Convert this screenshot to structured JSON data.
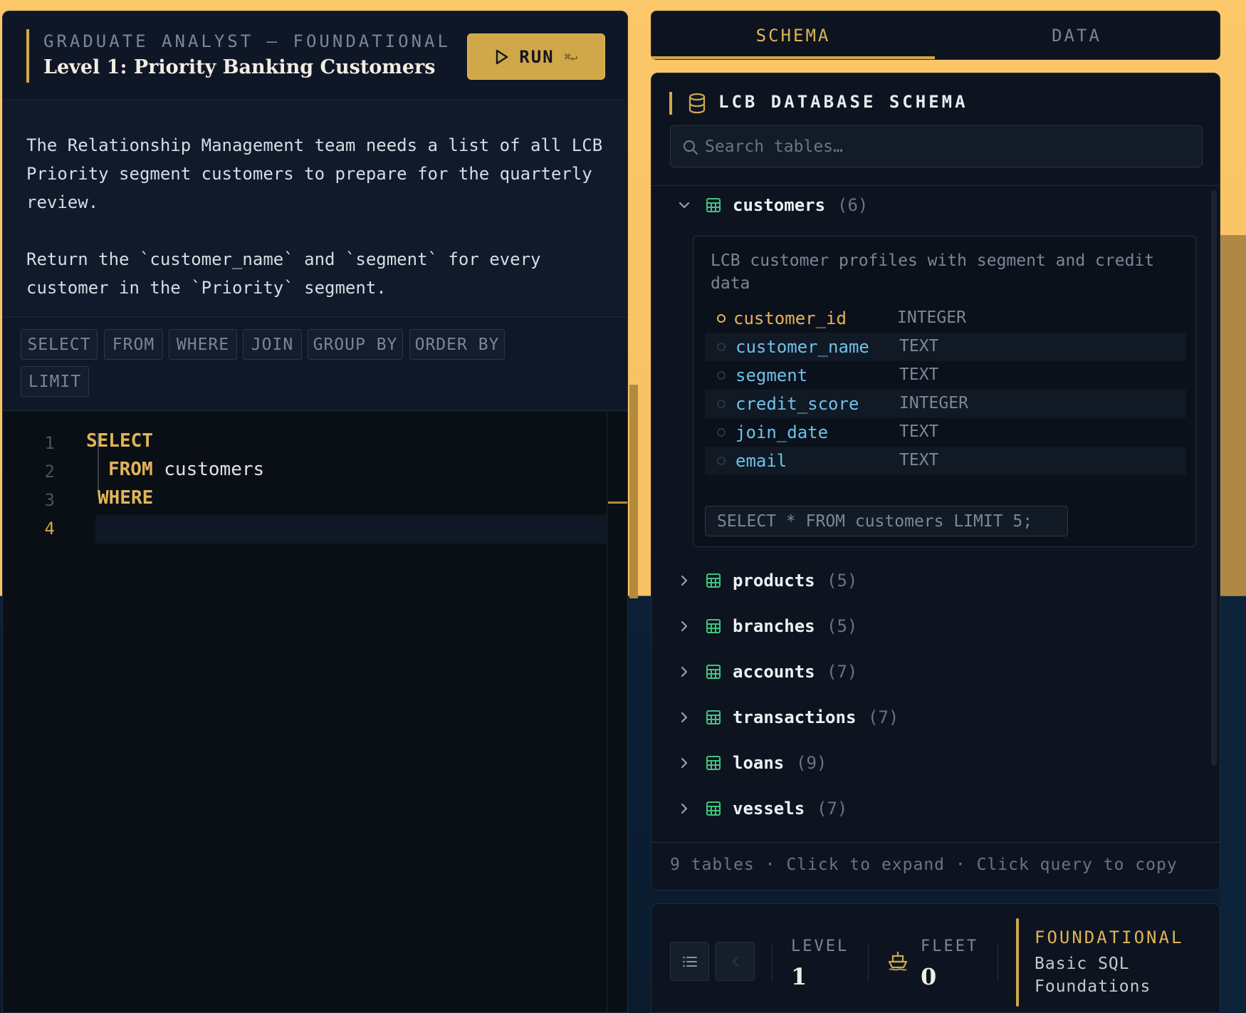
{
  "header": {
    "kicker": "GRADUATE ANALYST — FOUNDATIONAL",
    "title": "Level 1: Priority Banking Customers",
    "run_label": "RUN",
    "run_shortcut": "⌘↵"
  },
  "description": {
    "paragraph1": "The Relationship Management team needs a list of all LCB Priority segment customers to prepare for the quarterly review.",
    "paragraph2": "Return the `customer_name` and `segment` for every customer in the `Priority` segment."
  },
  "keywords": [
    "SELECT",
    "FROM",
    "WHERE",
    "JOIN",
    "GROUP BY",
    "ORDER BY",
    "LIMIT"
  ],
  "editor": {
    "line_numbers": [
      "1",
      "2",
      "3",
      "4"
    ],
    "lines": [
      {
        "keyword": "SELECT",
        "rest": ""
      },
      {
        "keyword": "FROM",
        "rest": " customers"
      },
      {
        "keyword": "WHERE",
        "rest": ""
      },
      {
        "keyword": "",
        "rest": ""
      }
    ]
  },
  "tabs": {
    "schema": "SCHEMA",
    "data": "DATA"
  },
  "schema": {
    "title": "LCB DATABASE SCHEMA",
    "search_placeholder": "Search tables…",
    "expanded_table": {
      "name": "customers",
      "count": "(6)",
      "description": "LCB customer profiles with segment and credit data",
      "columns": [
        {
          "name": "customer_id",
          "type": "INTEGER"
        },
        {
          "name": "customer_name",
          "type": "TEXT"
        },
        {
          "name": "segment",
          "type": "TEXT"
        },
        {
          "name": "credit_score",
          "type": "INTEGER"
        },
        {
          "name": "join_date",
          "type": "TEXT"
        },
        {
          "name": "email",
          "type": "TEXT"
        }
      ],
      "sample_query": "SELECT * FROM customers LIMIT 5;"
    },
    "tables": [
      {
        "name": "products",
        "count": "(5)"
      },
      {
        "name": "branches",
        "count": "(5)"
      },
      {
        "name": "accounts",
        "count": "(7)"
      },
      {
        "name": "transactions",
        "count": "(7)"
      },
      {
        "name": "loans",
        "count": "(9)"
      },
      {
        "name": "vessels",
        "count": "(7)"
      }
    ],
    "footer": "9 tables · Click to expand · Click query to copy"
  },
  "status": {
    "level_label": "LEVEL",
    "level_value": "1",
    "fleet_label": "FLEET",
    "fleet_value": "0",
    "tier": "FOUNDATIONAL",
    "tier_desc": "Basic SQL Foundations"
  },
  "icons": {
    "play": "play-icon",
    "database": "database-icon",
    "search": "search-icon",
    "table": "table-grid-icon",
    "chevron": "chevron-icon",
    "list": "list-icon",
    "back": "chevron-left-icon",
    "ship": "ship-icon"
  },
  "colors": {
    "accent": "#d1a849",
    "panel": "#0d1420",
    "column_name": "#6cc2ea",
    "table_icon": "#3fc47e"
  }
}
